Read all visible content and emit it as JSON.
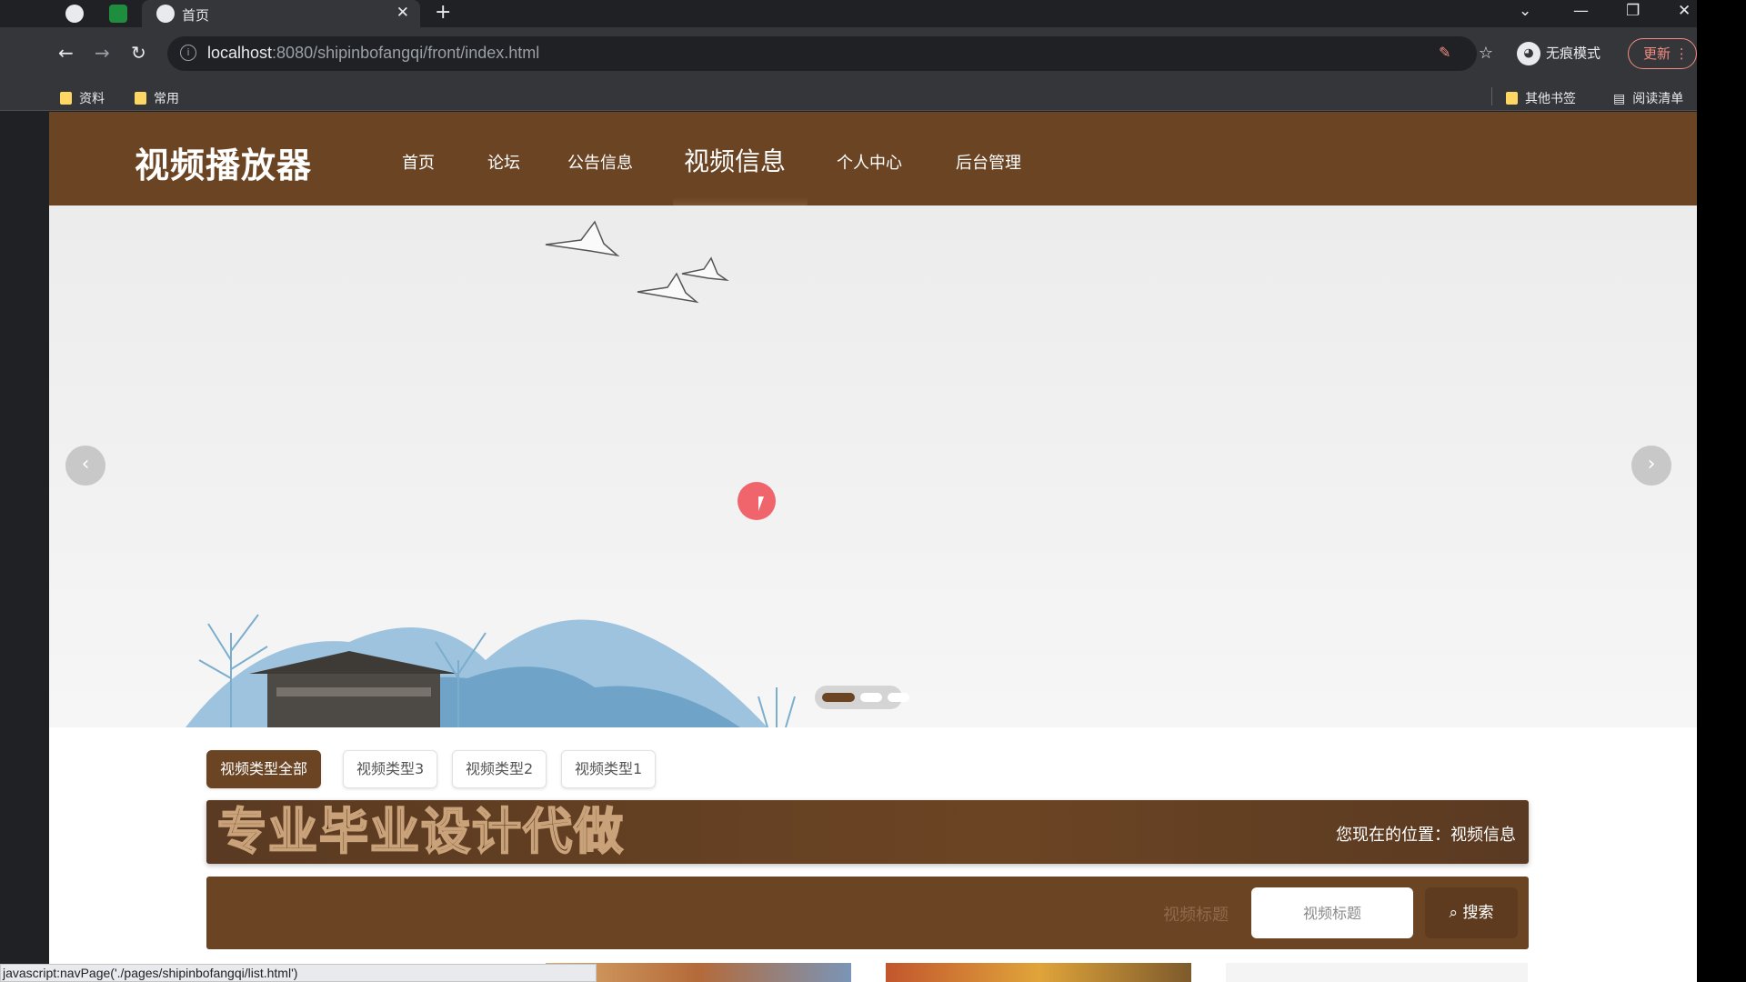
{
  "browser": {
    "tab_title": "首页",
    "url_host": "localhost",
    "url_rest": ":8080/shipinbofangqi/front/index.html",
    "profile_label": "无痕模式",
    "update_label": "更新",
    "bookmarks": [
      "资料",
      "常用"
    ],
    "bookmarks_right": [
      "其他书签",
      "阅读清单"
    ],
    "status_text": "javascript:navPage('./pages/shipinbofangqi/list.html')"
  },
  "site": {
    "logo": "视频播放器",
    "nav": [
      "首页",
      "论坛",
      "公告信息",
      "视频信息",
      "个人中心",
      "后台管理"
    ],
    "active_nav": "视频信息"
  },
  "filters": {
    "tabs": [
      "视频类型全部",
      "视频类型3",
      "视频类型2",
      "视频类型1"
    ]
  },
  "content": {
    "title": "专业毕业设计代做",
    "breadcrumb_label": "您现在的位置：",
    "breadcrumb_value": "视频信息"
  },
  "search": {
    "label": "视频标题",
    "placeholder": "视频标题",
    "button": "搜索"
  },
  "colors": {
    "brand": "#6b4423",
    "accent_dark": "#5e3b1f"
  }
}
